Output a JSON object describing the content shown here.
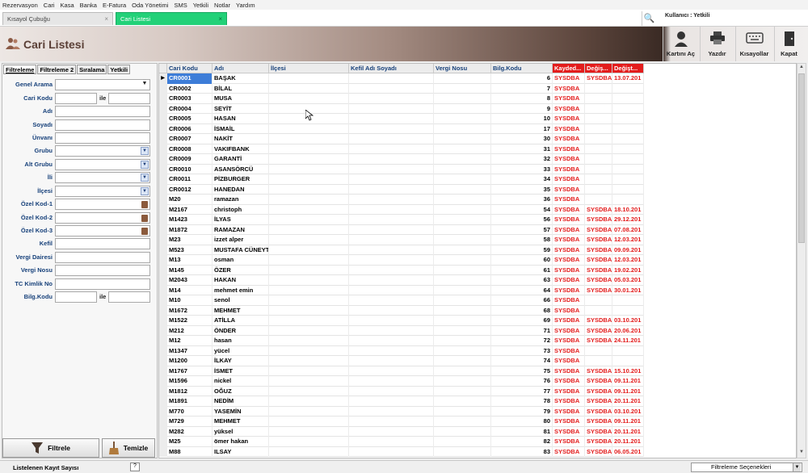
{
  "menu": [
    "Rezervasyon",
    "Cari",
    "Kasa",
    "Banka",
    "E-Fatura",
    "Oda Yönetimi",
    "SMS",
    "Yetkili",
    "Notlar",
    "Yardım"
  ],
  "tabs": [
    {
      "label": "Kısayol Çubuğu",
      "close": "×"
    },
    {
      "label": "Cari Listesi",
      "close": "×"
    }
  ],
  "user_label": "Kullanıcı : Yetkili",
  "header": {
    "title": "Cari Listesi",
    "buttons": {
      "open": "Kartını Aç",
      "print": "Yazdır",
      "shortcuts": "Kısayollar",
      "close": "Kapat"
    }
  },
  "filter": {
    "tabs": [
      "Filtreleme",
      "Filtreleme 2",
      "Sıralama",
      "Yetkili"
    ],
    "labels": {
      "genel_arama": "Genel Arama",
      "cari_kodu": "Cari Kodu",
      "ile": "ile",
      "adi": "Adı",
      "soyadi": "Soyadı",
      "unvani": "Ünvanı",
      "grubu": "Grubu",
      "alt_grubu": "Alt Grubu",
      "ili": "İli",
      "ilcesi": "İlçesi",
      "ozel1": "Özel Kod-1",
      "ozel2": "Özel Kod-2",
      "ozel3": "Özel Kod-3",
      "kefil": "Kefil",
      "vergi_dairesi": "Vergi Dairesi",
      "vergi_nosu": "Vergi Nosu",
      "tc": "TC Kimlik No",
      "bilg": "Bilg.Kodu"
    },
    "filter_button": "Filtrele",
    "clear_button": "Temizle"
  },
  "grid": {
    "headers": {
      "kod": "Cari Kodu",
      "adi": "Adı",
      "ilce": "İlçesi",
      "kefil": "Kefil Adı Soyadı",
      "vn": "Vergi Nosu",
      "bk": "Bilg.Kodu",
      "kay": "Kayded...",
      "deg": "Değiş...",
      "dt": "Değişt..."
    },
    "rows": [
      [
        "CR0001",
        "BAŞAK",
        "6",
        "SYSDBA",
        "SYSDBA",
        "13.07.201"
      ],
      [
        "CR0002",
        "BİLAL",
        "7",
        "SYSDBA",
        "",
        ""
      ],
      [
        "CR0003",
        "MUSA",
        "8",
        "SYSDBA",
        "",
        ""
      ],
      [
        "CR0004",
        "SEYİT",
        "9",
        "SYSDBA",
        "",
        ""
      ],
      [
        "CR0005",
        "HASAN",
        "10",
        "SYSDBA",
        "",
        ""
      ],
      [
        "CR0006",
        "İSMAİL",
        "17",
        "SYSDBA",
        "",
        ""
      ],
      [
        "CR0007",
        "NAKİT",
        "30",
        "SYSDBA",
        "",
        ""
      ],
      [
        "CR0008",
        "VAKIFBANK",
        "31",
        "SYSDBA",
        "",
        ""
      ],
      [
        "CR0009",
        "GARANTİ",
        "32",
        "SYSDBA",
        "",
        ""
      ],
      [
        "CR0010",
        "ASANSÖRCÜ",
        "33",
        "SYSDBA",
        "",
        ""
      ],
      [
        "CR0011",
        "PİZBURGER",
        "34",
        "SYSDBA",
        "",
        ""
      ],
      [
        "CR0012",
        "HANEDAN",
        "35",
        "SYSDBA",
        "",
        ""
      ],
      [
        "M20",
        "ramazan",
        "36",
        "SYSDBA",
        "",
        ""
      ],
      [
        "M2167",
        "christoph",
        "54",
        "SYSDBA",
        "SYSDBA",
        "18.10.201"
      ],
      [
        "M1423",
        "İLYAS",
        "56",
        "SYSDBA",
        "SYSDBA",
        "29.12.201"
      ],
      [
        "M1872",
        "RAMAZAN",
        "57",
        "SYSDBA",
        "SYSDBA",
        "07.08.201"
      ],
      [
        "M23",
        "izzet alper",
        "58",
        "SYSDBA",
        "SYSDBA",
        "12.03.201"
      ],
      [
        "M523",
        "MUSTAFA CÜNEYT",
        "59",
        "SYSDBA",
        "SYSDBA",
        "09.09.201"
      ],
      [
        "M13",
        "osman",
        "60",
        "SYSDBA",
        "SYSDBA",
        "12.03.201"
      ],
      [
        "M145",
        "ÖZER",
        "61",
        "SYSDBA",
        "SYSDBA",
        "19.02.201"
      ],
      [
        "M2043",
        "HAKAN",
        "63",
        "SYSDBA",
        "SYSDBA",
        "05.03.201"
      ],
      [
        "M14",
        "mehmet emin",
        "64",
        "SYSDBA",
        "SYSDBA",
        "30.01.201"
      ],
      [
        "M10",
        "senol",
        "66",
        "SYSDBA",
        "",
        ""
      ],
      [
        "M1672",
        "MEHMET",
        "68",
        "SYSDBA",
        "",
        ""
      ],
      [
        "M1522",
        "ATİLLA",
        "69",
        "SYSDBA",
        "SYSDBA",
        "03.10.201"
      ],
      [
        "M212",
        "ÖNDER",
        "71",
        "SYSDBA",
        "SYSDBA",
        "20.06.201"
      ],
      [
        "M12",
        "hasan",
        "72",
        "SYSDBA",
        "SYSDBA",
        "24.11.201"
      ],
      [
        "M1347",
        "yücel",
        "73",
        "SYSDBA",
        "",
        ""
      ],
      [
        "M1200",
        "İLKAY",
        "74",
        "SYSDBA",
        "",
        ""
      ],
      [
        "M1767",
        "İSMET",
        "75",
        "SYSDBA",
        "SYSDBA",
        "15.10.201"
      ],
      [
        "M1596",
        "nickel",
        "76",
        "SYSDBA",
        "SYSDBA",
        "09.11.201"
      ],
      [
        "M1812",
        "OĞUZ",
        "77",
        "SYSDBA",
        "SYSDBA",
        "09.11.201"
      ],
      [
        "M1891",
        "NEDİM",
        "78",
        "SYSDBA",
        "SYSDBA",
        "20.11.201"
      ],
      [
        "M770",
        "YASEMİN",
        "79",
        "SYSDBA",
        "SYSDBA",
        "03.10.201"
      ],
      [
        "M729",
        "MEHMET",
        "80",
        "SYSDBA",
        "SYSDBA",
        "09.11.201"
      ],
      [
        "M282",
        "yüksel",
        "81",
        "SYSDBA",
        "SYSDBA",
        "20.11.201"
      ],
      [
        "M25",
        "ömer hakan",
        "82",
        "SYSDBA",
        "SYSDBA",
        "20.11.201"
      ],
      [
        "M88",
        "ILSAY",
        "83",
        "SYSDBA",
        "SYSDBA",
        "06.05.201"
      ]
    ]
  },
  "status": {
    "label": "Listelenen Kayıt Sayısı",
    "help": "?",
    "select": "Filtreleme Seçenekleri"
  }
}
